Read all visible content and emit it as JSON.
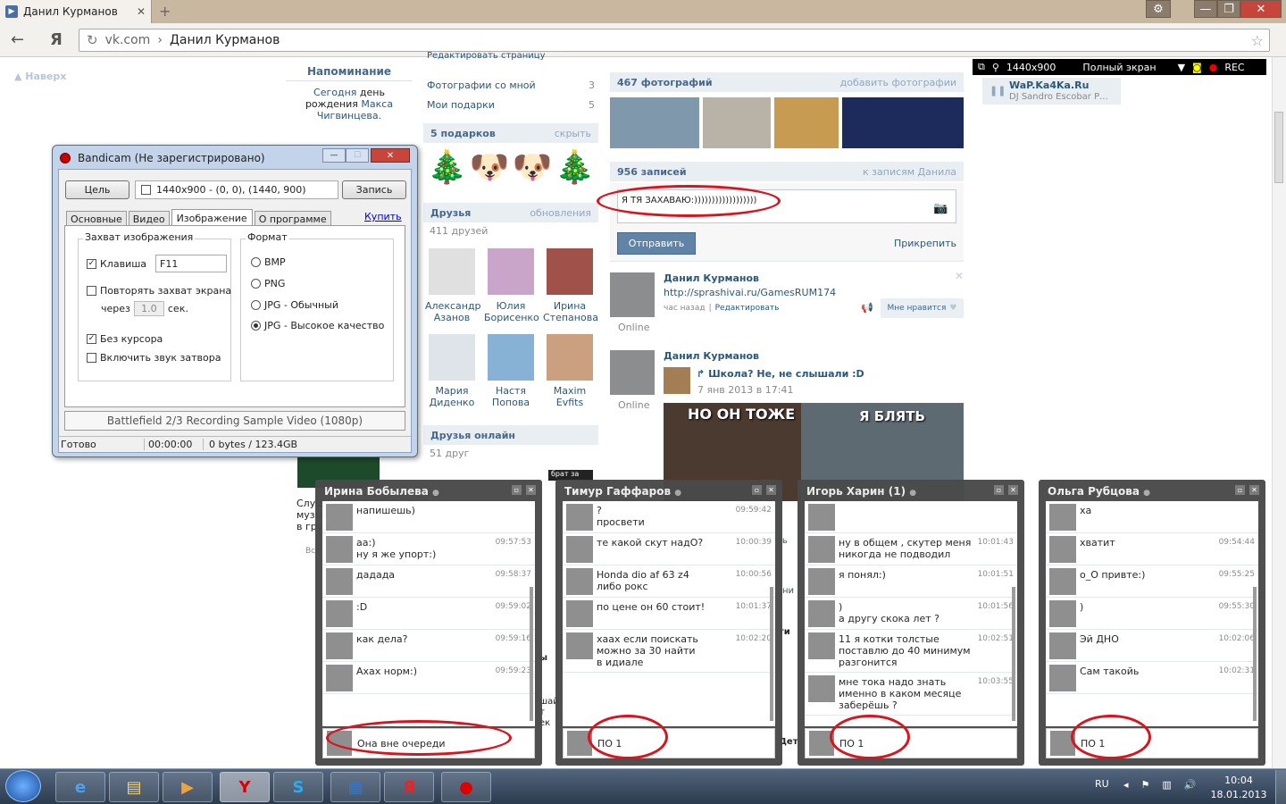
{
  "browser": {
    "tab_title": "Данил Курманов",
    "url_domain": "vk.com",
    "url_sep": "›",
    "url_page": "Данил Курманов",
    "nav_y": "Я"
  },
  "vk": {
    "naverh": "Наверх",
    "reminder": {
      "title": "Напоминание",
      "line1": "Сегодня",
      "line1b": "день",
      "line2": "рождения",
      "name1": "Макса",
      "name2": "Чигвинцева."
    },
    "edit_page": "Редактировать страницу",
    "photos_with_me": "Фотографии со мной",
    "photos_with_me_count": "3",
    "my_gifts": "Мои подарки",
    "my_gifts_count": "5",
    "gifts_header": "5 подарков",
    "gifts_hide": "скрыть",
    "friends_header": "Друзья",
    "friends_updates": "обновления",
    "friends_count": "411 друзей",
    "friends": [
      {
        "first": "Александр",
        "last": "Азанов"
      },
      {
        "first": "Юлия",
        "last": "Борисенко"
      },
      {
        "first": "Ирина",
        "last": "Степанова"
      },
      {
        "first": "Мария",
        "last": "Диденко"
      },
      {
        "first": "Настя",
        "last": "Попова"
      },
      {
        "first": "Maxim",
        "last": "Evfits"
      }
    ],
    "online_header": "Друзья онлайн",
    "online_count": "51 друг",
    "photos_header": "467 фотографий",
    "photos_add": "добавить фотографии",
    "posts_header": "956 записей",
    "posts_link": "к записям Данила",
    "compose_text": "Я ТЯ ЗАХАВАЮ:))))))))))))))))))",
    "send": "Отправить",
    "attach": "Прикрепить",
    "post1": {
      "author": "Данил Курманов",
      "link": "http://sprashivai.ru/GamesRUM174",
      "time": "час назад",
      "sep": "|",
      "edit": "Редактировать",
      "like": "Мне нравится",
      "online": "Online"
    },
    "post2": {
      "author": "Данил Курманов",
      "repost": "Школа? Не, не слышали :D",
      "date": "7 янв 2013 в 17:41",
      "online": "Online",
      "meme_left": "НО ОН ТОЖЕ",
      "meme_right": "Я БЛЯТЬ"
    },
    "audio": {
      "res": "1440x900",
      "fullscreen": "Полный экран",
      "rec": "REC",
      "title": "WaP.Ka4Ka.Ru",
      "artist": "DJ Sandro Escobar Р..."
    },
    "partial_left": [
      "Слуш",
      "музык",
      "в груп",
      "Все"
    ],
    "partial_mid": [
      "ть",
      "ни",
      "ти",
      "ы",
      "шай",
      "т",
      "ек",
      "Дет",
      "брат за"
    ]
  },
  "bandicam": {
    "title": "Bandicam (Не зарегистрировано)",
    "target": "Цель",
    "area": "1440x900 - (0, 0), (1440, 900)",
    "record": "Запись",
    "tabs": [
      "Основные",
      "Видео",
      "Изображение",
      "О программе"
    ],
    "buy": "Купить",
    "capture_group": "Захват изображения",
    "hotkey_label": "Клавиша",
    "hotkey_value": "F11",
    "repeat_label": "Повторять захват экрана",
    "every": "через",
    "interval": "1.0",
    "sec": "сек.",
    "no_cursor": "Без курсора",
    "shutter": "Включить звук затвора",
    "format_group": "Формат",
    "formats": [
      "BMP",
      "PNG",
      "JPG - Обычный",
      "JPG - Высокое качество"
    ],
    "banner": "Battlefield 2/3 Recording Sample Video (1080p)",
    "status": "Готово",
    "time": "00:00:00",
    "size": "0 bytes / 123.4GB"
  },
  "chats": [
    {
      "name": "Ирина Бобылева",
      "messages": [
        {
          "text": "напишешь)",
          "time": ""
        },
        {
          "text": "аа:)\nну я же упорт:)",
          "time": "09:57:53"
        },
        {
          "text": "дадада",
          "time": "09:58:37"
        },
        {
          "text": ":D",
          "time": "09:59:02"
        },
        {
          "text": "как дела?",
          "time": "09:59:16"
        },
        {
          "text": "Ахах норм:)",
          "time": "09:59:23"
        }
      ],
      "input": "Она вне очереди"
    },
    {
      "name": "Тимур Гаффаров",
      "messages": [
        {
          "text": "?\nпросвети",
          "time": "09:59:42"
        },
        {
          "text": "те какой скут надО?",
          "time": "10:00:39"
        },
        {
          "text": "Honda dio af 63 z4\nлибо рокс",
          "time": "10:00:56"
        },
        {
          "text": "по цене он 60 стоит!",
          "time": "10:01:37"
        },
        {
          "text": "хаах если поискать можно за 30 найти\nв идиале",
          "time": "10:02:20"
        }
      ],
      "input": "ПО 1"
    },
    {
      "name": "Игорь Харин (1)",
      "messages": [
        {
          "text": "",
          "time": ""
        },
        {
          "text": "ну в общем , скутер меня никогда не подводил",
          "time": "10:01:43"
        },
        {
          "text": "я понял:)",
          "time": "10:01:51"
        },
        {
          "text": ")\nа другу скока лет ?",
          "time": "10:01:56"
        },
        {
          "text": "11 я котки толстые поставлю до 40 минимум разгонится",
          "time": "10:02:51"
        },
        {
          "text": "мне тока надо знать именно в каком месяце заберёшь ?",
          "time": "10:03:55"
        }
      ],
      "input": "ПО 1"
    },
    {
      "name": "Ольга Рубцова",
      "messages": [
        {
          "text": "ха",
          "time": ""
        },
        {
          "text": "хватит",
          "time": "09:54:44"
        },
        {
          "text": "о_О привте:)",
          "time": "09:55:25"
        },
        {
          "text": ")",
          "time": "09:55:30"
        },
        {
          "text": "Эй ДНО",
          "time": "10:02:06"
        },
        {
          "text": "Сам такойь",
          "time": "10:02:31"
        }
      ],
      "input": "ПО 1"
    }
  ],
  "taskbar": {
    "lang": "RU",
    "time": "10:04",
    "date": "18.01.2013"
  }
}
